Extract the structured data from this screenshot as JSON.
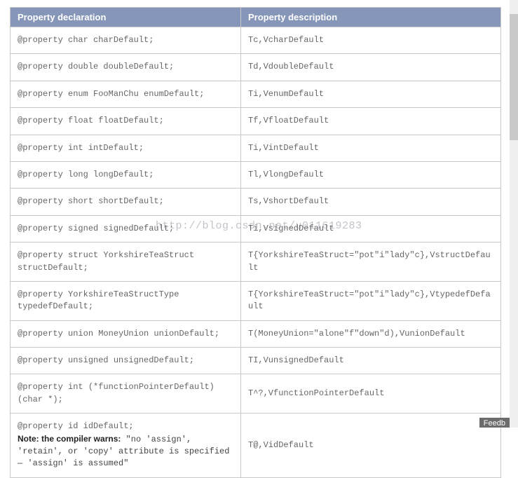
{
  "table": {
    "headers": {
      "col1": "Property declaration",
      "col2": "Property description"
    },
    "rows": [
      {
        "decl": "@property char charDefault;",
        "desc": "Tc,VcharDefault"
      },
      {
        "decl": "@property double doubleDefault;",
        "desc": "Td,VdoubleDefault"
      },
      {
        "decl": "@property enum FooManChu enumDefault;",
        "desc": "Ti,VenumDefault"
      },
      {
        "decl": "@property float floatDefault;",
        "desc": "Tf,VfloatDefault"
      },
      {
        "decl": "@property int intDefault;",
        "desc": "Ti,VintDefault"
      },
      {
        "decl": "@property long longDefault;",
        "desc": "Tl,VlongDefault"
      },
      {
        "decl": "@property short shortDefault;",
        "desc": "Ts,VshortDefault"
      },
      {
        "decl": "@property signed signedDefault;",
        "desc": "Ti,VsignedDefault"
      },
      {
        "decl": "@property struct YorkshireTeaStruct structDefault;",
        "desc": "T{YorkshireTeaStruct=\"pot\"i\"lady\"c},VstructDefault"
      },
      {
        "decl": "@property YorkshireTeaStructType typedefDefault;",
        "desc": "T{YorkshireTeaStruct=\"pot\"i\"lady\"c},VtypedefDefault"
      },
      {
        "decl": "@property union MoneyUnion unionDefault;",
        "desc": "T(MoneyUnion=\"alone\"f\"down\"d),VunionDefault"
      },
      {
        "decl": "@property unsigned unsignedDefault;",
        "desc": "TI,VunsignedDefault"
      },
      {
        "decl": "@property int (*functionPointerDefault)(char *);",
        "desc": "T^?,VfunctionPointerDefault"
      },
      {
        "decl_pre": "@property id idDefault;",
        "note_label": "Note: the compiler warns:",
        "note_text": " \"no 'assign', 'retain', or 'copy' attribute is specified — 'assign' is assumed\"",
        "desc": "T@,VidDefault"
      }
    ]
  },
  "watermark": "http://blog.csdn.net/u011619283",
  "feedback_label": "Feedb"
}
